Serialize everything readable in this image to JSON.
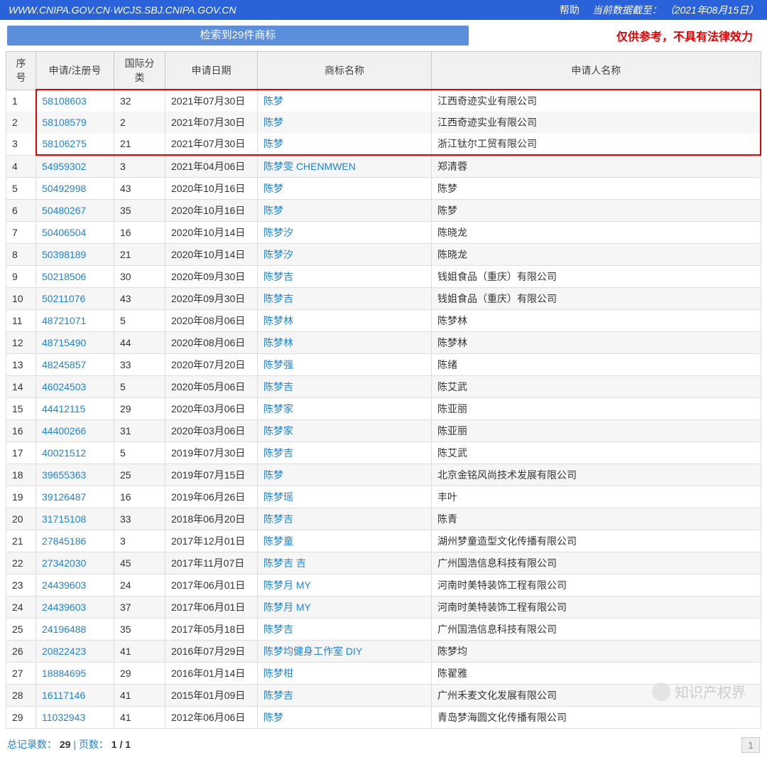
{
  "topbar": {
    "url": "WWW.CNIPA.GOV.CN·WCJS.SBJ.CNIPA.GOV.CN",
    "help": "帮助",
    "cutoff_label": "当前数据截至：",
    "cutoff_date": "（2021年08月15日）"
  },
  "header": {
    "result_text": "检索到29件商标",
    "disclaimer": "仅供参考，不具有法律效力"
  },
  "columns": {
    "idx": "序号",
    "reg": "申请/注册号",
    "cls": "国际分类",
    "date": "申请日期",
    "name": "商标名称",
    "applicant": "申请人名称"
  },
  "rows": [
    {
      "idx": "1",
      "reg": "58108603",
      "cls": "32",
      "date": "2021年07月30日",
      "name": "陈梦",
      "applicant": "江西奇迹实业有限公司",
      "hl": true
    },
    {
      "idx": "2",
      "reg": "58108579",
      "cls": "2",
      "date": "2021年07月30日",
      "name": "陈梦",
      "applicant": "江西奇迹实业有限公司",
      "hl": true
    },
    {
      "idx": "3",
      "reg": "58106275",
      "cls": "21",
      "date": "2021年07月30日",
      "name": "陈梦",
      "applicant": "浙江钛尔工贸有限公司",
      "hl": true
    },
    {
      "idx": "4",
      "reg": "54959302",
      "cls": "3",
      "date": "2021年04月06日",
      "name": "陈梦雯 CHENMWEN",
      "applicant": "郑清蓉"
    },
    {
      "idx": "5",
      "reg": "50492998",
      "cls": "43",
      "date": "2020年10月16日",
      "name": "陈梦",
      "applicant": "陈梦"
    },
    {
      "idx": "6",
      "reg": "50480267",
      "cls": "35",
      "date": "2020年10月16日",
      "name": "陈梦",
      "applicant": "陈梦"
    },
    {
      "idx": "7",
      "reg": "50406504",
      "cls": "16",
      "date": "2020年10月14日",
      "name": "陈梦汐",
      "applicant": "陈晓龙"
    },
    {
      "idx": "8",
      "reg": "50398189",
      "cls": "21",
      "date": "2020年10月14日",
      "name": "陈梦汐",
      "applicant": "陈晓龙"
    },
    {
      "idx": "9",
      "reg": "50218506",
      "cls": "30",
      "date": "2020年09月30日",
      "name": "陈梦吉",
      "applicant": "钱姐食品（重庆）有限公司"
    },
    {
      "idx": "10",
      "reg": "50211076",
      "cls": "43",
      "date": "2020年09月30日",
      "name": "陈梦吉",
      "applicant": "钱姐食品（重庆）有限公司"
    },
    {
      "idx": "11",
      "reg": "48721071",
      "cls": "5",
      "date": "2020年08月06日",
      "name": "陈梦林",
      "applicant": "陈梦林"
    },
    {
      "idx": "12",
      "reg": "48715490",
      "cls": "44",
      "date": "2020年08月06日",
      "name": "陈梦林",
      "applicant": "陈梦林"
    },
    {
      "idx": "13",
      "reg": "48245857",
      "cls": "33",
      "date": "2020年07月20日",
      "name": "陈梦强",
      "applicant": "陈绪"
    },
    {
      "idx": "14",
      "reg": "46024503",
      "cls": "5",
      "date": "2020年05月06日",
      "name": "陈梦吉",
      "applicant": "陈艾武"
    },
    {
      "idx": "15",
      "reg": "44412115",
      "cls": "29",
      "date": "2020年03月06日",
      "name": "陈梦家",
      "applicant": "陈亚丽"
    },
    {
      "idx": "16",
      "reg": "44400266",
      "cls": "31",
      "date": "2020年03月06日",
      "name": "陈梦家",
      "applicant": "陈亚丽"
    },
    {
      "idx": "17",
      "reg": "40021512",
      "cls": "5",
      "date": "2019年07月30日",
      "name": "陈梦吉",
      "applicant": "陈艾武"
    },
    {
      "idx": "18",
      "reg": "39655363",
      "cls": "25",
      "date": "2019年07月15日",
      "name": "陈梦",
      "applicant": "北京金铭风尚技术发展有限公司"
    },
    {
      "idx": "19",
      "reg": "39126487",
      "cls": "16",
      "date": "2019年06月26日",
      "name": "陈梦瑶",
      "applicant": "丰叶"
    },
    {
      "idx": "20",
      "reg": "31715108",
      "cls": "33",
      "date": "2018年06月20日",
      "name": "陈梦吉",
      "applicant": "陈青"
    },
    {
      "idx": "21",
      "reg": "27845186",
      "cls": "3",
      "date": "2017年12月01日",
      "name": "陈梦童",
      "applicant": "湖州梦童造型文化传播有限公司"
    },
    {
      "idx": "22",
      "reg": "27342030",
      "cls": "45",
      "date": "2017年11月07日",
      "name": "陈梦吉 吉",
      "applicant": "广州国浩信息科技有限公司"
    },
    {
      "idx": "23",
      "reg": "24439603",
      "cls": "24",
      "date": "2017年06月01日",
      "name": "陈梦月 MY",
      "applicant": "河南时美特装饰工程有限公司"
    },
    {
      "idx": "24",
      "reg": "24439603",
      "cls": "37",
      "date": "2017年06月01日",
      "name": "陈梦月 MY",
      "applicant": "河南时美特装饰工程有限公司"
    },
    {
      "idx": "25",
      "reg": "24196488",
      "cls": "35",
      "date": "2017年05月18日",
      "name": "陈梦吉",
      "applicant": "广州国浩信息科技有限公司"
    },
    {
      "idx": "26",
      "reg": "20822423",
      "cls": "41",
      "date": "2016年07月29日",
      "name": "陈梦均健身工作室 DIY",
      "applicant": "陈梦均"
    },
    {
      "idx": "27",
      "reg": "18884695",
      "cls": "29",
      "date": "2016年01月14日",
      "name": "陈梦柑",
      "applicant": "陈翟雅"
    },
    {
      "idx": "28",
      "reg": "16117146",
      "cls": "41",
      "date": "2015年01月09日",
      "name": "陈梦吉",
      "applicant": "广州禾麦文化发展有限公司"
    },
    {
      "idx": "29",
      "reg": "11032943",
      "cls": "41",
      "date": "2012年06月06日",
      "name": "陈梦",
      "applicant": "青岛梦海圆文化传播有限公司"
    }
  ],
  "footer": {
    "total_label": "总记录数：",
    "total_value": "29",
    "sep": " | ",
    "page_label": "页数：",
    "page_value": "1 / 1",
    "pager_current": "1"
  },
  "watermark": {
    "text": "知识产权界"
  }
}
